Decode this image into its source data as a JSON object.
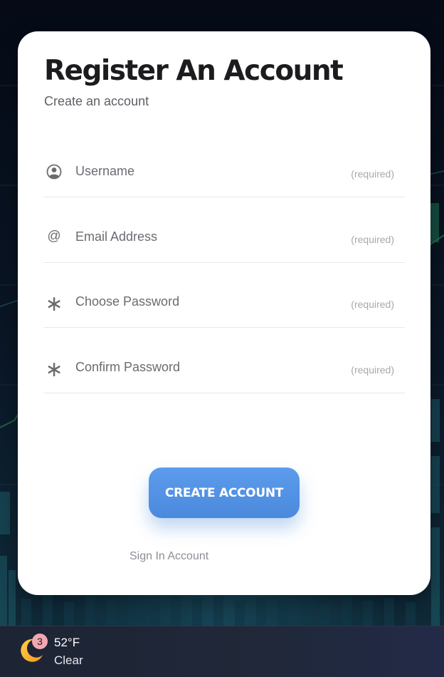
{
  "form": {
    "title": "Register An Account",
    "subtitle": "Create an account",
    "fields": [
      {
        "icon": "user-circle-icon",
        "placeholder": "Username",
        "value": "",
        "hint": "(required)"
      },
      {
        "icon": "at-sign-icon",
        "placeholder": "Email Address",
        "value": "",
        "hint": "(required)"
      },
      {
        "icon": "asterisk-icon",
        "placeholder": "Choose Password",
        "value": "",
        "hint": "(required)"
      },
      {
        "icon": "asterisk-icon",
        "placeholder": "Confirm Password",
        "value": "",
        "hint": "(required)"
      }
    ],
    "submit_label": "CREATE ACCOUNT",
    "signin_label": "Sign In Account",
    "accent_color": "#4a89dc"
  },
  "taskbar": {
    "weather": {
      "icon": "moon-icon",
      "badge": "3",
      "temperature": "52°F",
      "condition": "Clear"
    }
  }
}
